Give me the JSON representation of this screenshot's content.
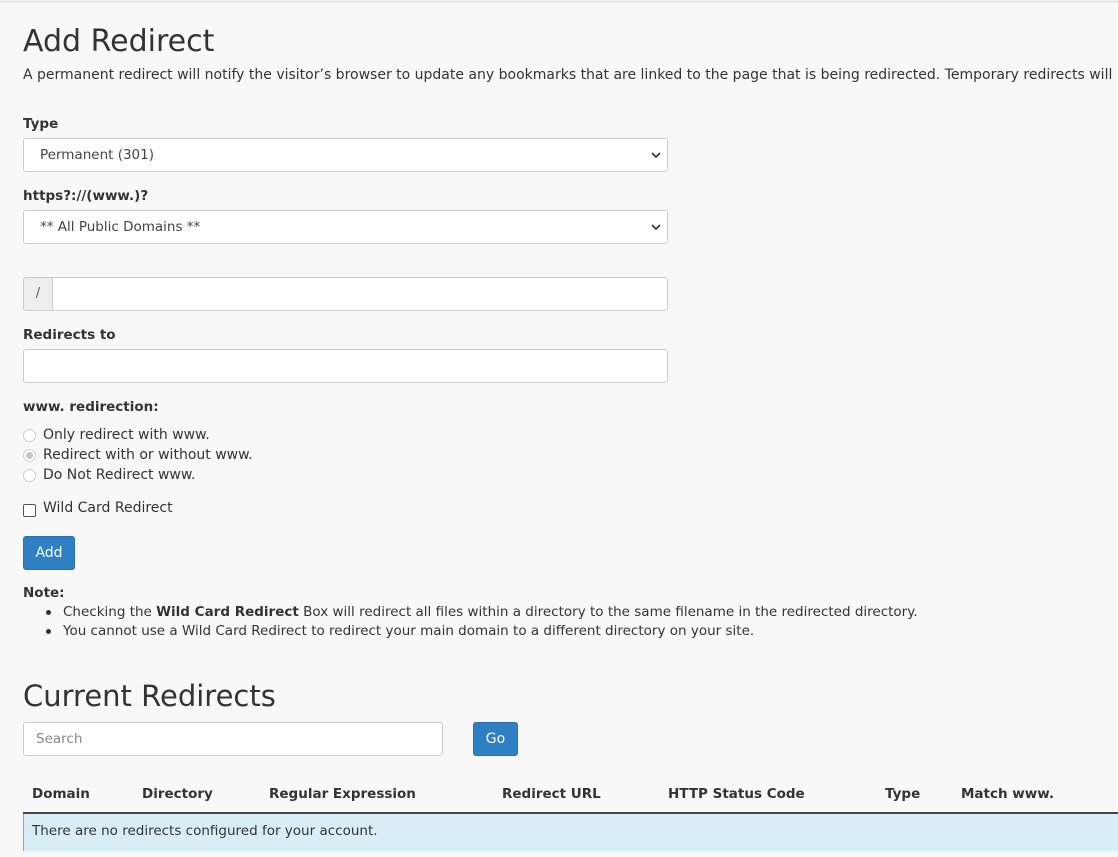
{
  "add_redirect": {
    "title": "Add Redirect",
    "description": "A permanent redirect will notify the visitor’s browser to update any bookmarks that are linked to the page that is being redirected. Temporary redirects will not update the visitor’s bookmarks.",
    "type_label": "Type",
    "type_value": "Permanent (301)",
    "domain_label": "https?://(www.)?",
    "domain_value": "** All Public Domains **",
    "path_prefix": "/",
    "path_value": "",
    "redirects_to_label": "Redirects to",
    "redirects_to_value": "",
    "www_label": "www. redirection:",
    "www_options": [
      {
        "label": "Only redirect with www.",
        "checked": false
      },
      {
        "label": "Redirect with or without www.",
        "checked": true
      },
      {
        "label": "Do Not Redirect www.",
        "checked": false
      }
    ],
    "wildcard_label": "Wild Card Redirect",
    "wildcard_checked": false,
    "add_button": "Add",
    "note": {
      "title": "Note:",
      "item1_pre": "Checking the ",
      "item1_bold": "Wild Card Redirect",
      "item1_post": " Box will redirect all files within a directory to the same filename in the redirected directory.",
      "item2": "You cannot use a Wild Card Redirect to redirect your main domain to a different directory on your site."
    }
  },
  "current_redirects": {
    "title": "Current Redirects",
    "search_placeholder": "Search",
    "go_button": "Go",
    "columns": [
      "Domain",
      "Directory",
      "Regular Expression",
      "Redirect URL",
      "HTTP Status Code",
      "Type",
      "Match www."
    ],
    "empty_message": "There are no redirects configured for your account."
  },
  "colors": {
    "button": "#2f7fc4",
    "info_row": "#d9edf7",
    "background": "#f8f8f8"
  }
}
